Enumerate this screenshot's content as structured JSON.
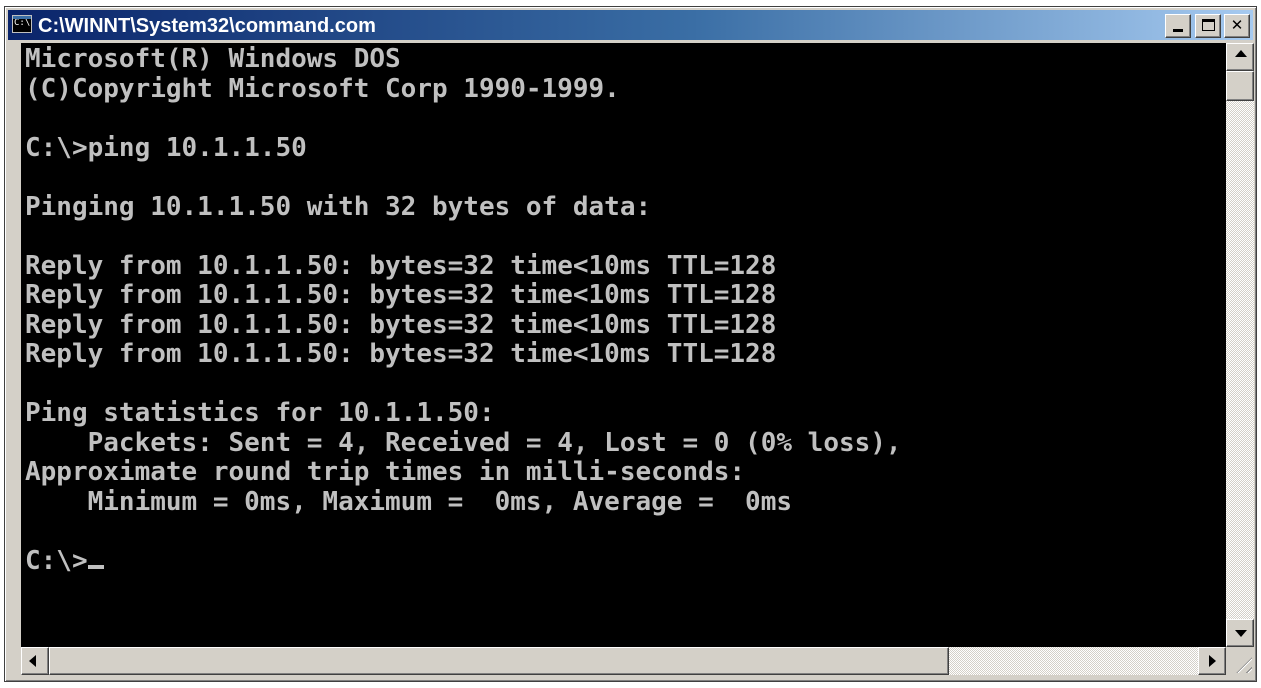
{
  "window": {
    "title": "C:\\WINNT\\System32\\command.com",
    "app_icon": "C:\\"
  },
  "controls": {
    "minimize_icon": "minimize-icon",
    "maximize_icon": "maximize-icon",
    "close_icon": "close-icon",
    "close_glyph": "✕"
  },
  "console": {
    "lines": [
      "Microsoft(R) Windows DOS",
      "(C)Copyright Microsoft Corp 1990-1999.",
      "",
      "C:\\>ping 10.1.1.50",
      "",
      "Pinging 10.1.1.50 with 32 bytes of data:",
      "",
      "Reply from 10.1.1.50: bytes=32 time<10ms TTL=128",
      "Reply from 10.1.1.50: bytes=32 time<10ms TTL=128",
      "Reply from 10.1.1.50: bytes=32 time<10ms TTL=128",
      "Reply from 10.1.1.50: bytes=32 time<10ms TTL=128",
      "",
      "Ping statistics for 10.1.1.50:",
      "    Packets: Sent = 4, Received = 4, Lost = 0 (0% loss),",
      "Approximate round trip times in milli-seconds:",
      "    Minimum = 0ms, Maximum =  0ms, Average =  0ms",
      "",
      "C:\\>"
    ]
  },
  "colors": {
    "console_bg": "#000000",
    "console_text": "#c0c0c0",
    "titlebar_start": "#0a246a",
    "titlebar_end": "#a6caf0"
  }
}
